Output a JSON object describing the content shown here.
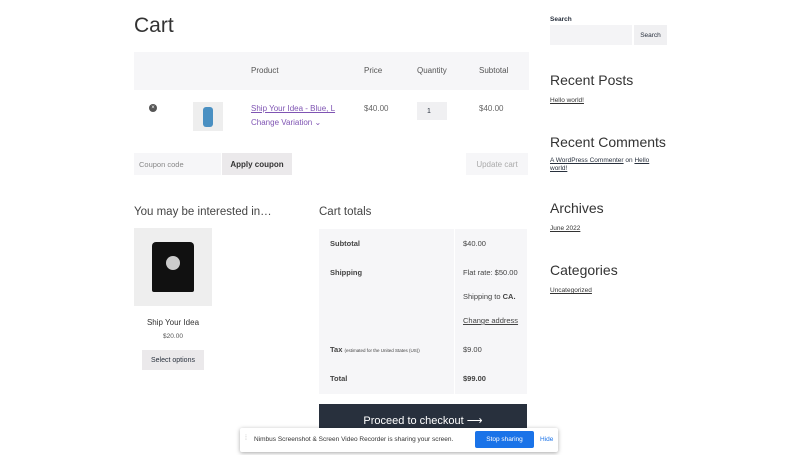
{
  "page_title": "Cart",
  "table": {
    "headers": [
      "Product",
      "Price",
      "Quantity",
      "Subtotal"
    ],
    "row": {
      "product": "Ship Your Idea - Blue, L",
      "variation": "Change Variation",
      "price": "$40.00",
      "quantity": "1",
      "subtotal": "$40.00"
    }
  },
  "coupon": {
    "placeholder": "Coupon code",
    "apply": "Apply coupon",
    "update": "Update cart"
  },
  "crosssell": {
    "heading": "You may be interested in…",
    "product": "Ship Your Idea",
    "price": "$20.00",
    "button": "Select options"
  },
  "totals": {
    "heading": "Cart totals",
    "subtotal_label": "Subtotal",
    "subtotal": "$40.00",
    "shipping_label": "Shipping",
    "shipping_rate": "Flat rate: $50.00",
    "shipping_to": "Shipping to",
    "shipping_dest": "CA.",
    "change_address": "Change address",
    "tax_label": "Tax",
    "tax_note": "(estimated for the United States (US))",
    "tax": "$9.00",
    "total_label": "Total",
    "total": "$99.00",
    "checkout": "Proceed to checkout"
  },
  "sidebar": {
    "search_label": "Search",
    "search_button": "Search",
    "recent_posts": "Recent Posts",
    "post": "Hello world!",
    "recent_comments": "Recent Comments",
    "commenter": "A WordPress Commenter",
    "on": "on",
    "comment_post": "Hello world!",
    "archives": "Archives",
    "archive": "June 2022",
    "categories": "Categories",
    "category": "Uncategorized"
  },
  "share_bar": {
    "message": "Nimbus Screenshot & Screen Video Recorder is sharing your screen.",
    "stop": "Stop sharing",
    "hide": "Hide"
  },
  "colors": {
    "link": "#7f54b3",
    "checkout_bg": "#28303d",
    "stop_button": "#1a73e8"
  }
}
